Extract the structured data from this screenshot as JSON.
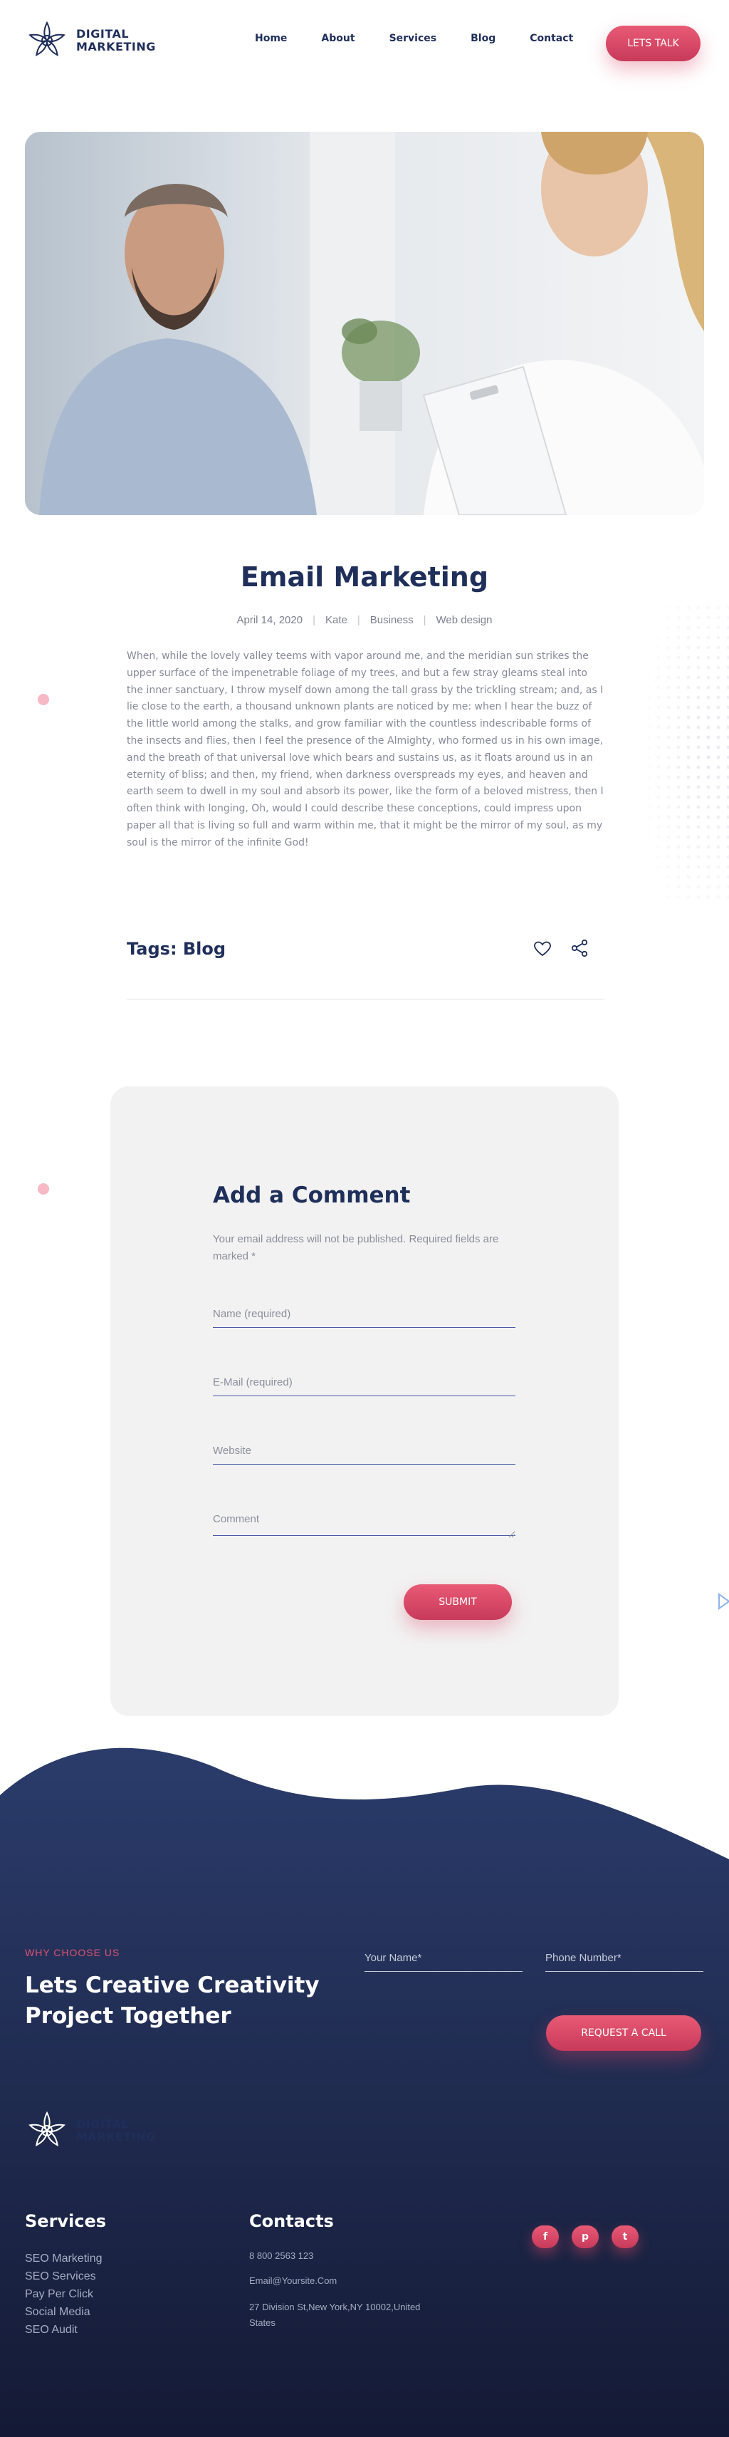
{
  "header": {
    "logo_line1": "DIGITAL",
    "logo_line2": "MARKETING",
    "nav": [
      "Home",
      "About",
      "Services",
      "Blog",
      "Contact"
    ],
    "cta_label": "LETS TALK"
  },
  "article": {
    "title": "Email Marketing",
    "meta": [
      "April 14, 2020",
      "Kate",
      "Business",
      "Web design"
    ],
    "body": "When, while the lovely valley teems with vapor around me, and the meridian sun strikes the upper surface of the impenetrable foliage of my trees, and but a few stray gleams steal into the inner sanctuary, I throw myself down among the tall grass by the trickling stream; and, as I lie close to the earth, a thousand unknown plants are noticed by me: when I hear the buzz of the little world among the stalks, and grow familiar with the countless indescribable forms of the insects and flies, then I feel the presence of the Almighty, who formed us in his own image, and the breath of that universal love which bears and sustains us, as it floats around us in an eternity of bliss; and then, my friend, when darkness overspreads my eyes, and heaven and earth seem to dwell in my soul and absorb its power, like the form of a beloved mistress, then I often think with longing, Oh, would I could describe these conceptions, could impress upon paper all that is living so full and warm within me, that it might be the mirror of my soul, as my soul is the mirror of the infinite God!",
    "tags_label": "Tags: Blog"
  },
  "comment_form": {
    "title": "Add a Comment",
    "note": "Your email address will not be published. Required fields are marked *",
    "name_placeholder": "Name (required)",
    "email_placeholder": "E-Mail (required)",
    "website_placeholder": "Website",
    "comment_placeholder": "Comment",
    "submit_label": "SUBMIT"
  },
  "footer": {
    "eyebrow": "WHY CHOOSE US",
    "cta_title": "Lets Creative Creativity Project Together",
    "your_name_placeholder": "Your Name*",
    "phone_placeholder": "Phone Number*",
    "request_label": "REQUEST A CALL",
    "logo_line1": "DIGITAL",
    "logo_line2": "MARKETING",
    "services_title": "Services",
    "services": [
      "SEO Marketing",
      "SEO Services",
      "Pay Per Click",
      "Social Media",
      "SEO Audit"
    ],
    "contacts_title": "Contacts",
    "phone": "8 800 2563 123",
    "email": "Email@Yoursite.Com",
    "address": "27 Division St,New York,NY 10002,United States",
    "social": [
      "f",
      "p",
      "t"
    ]
  },
  "colors": {
    "navy": "#1f2f5a",
    "accent_pink": "#e0516e",
    "footer_top": "#2b3c6b",
    "footer_bottom": "#141a35",
    "card_bg": "#f2f2f2"
  },
  "icons": {
    "logo": "lotus-logo-icon",
    "like": "heart-icon",
    "share": "share-icon",
    "play": "play-triangle-icon"
  }
}
